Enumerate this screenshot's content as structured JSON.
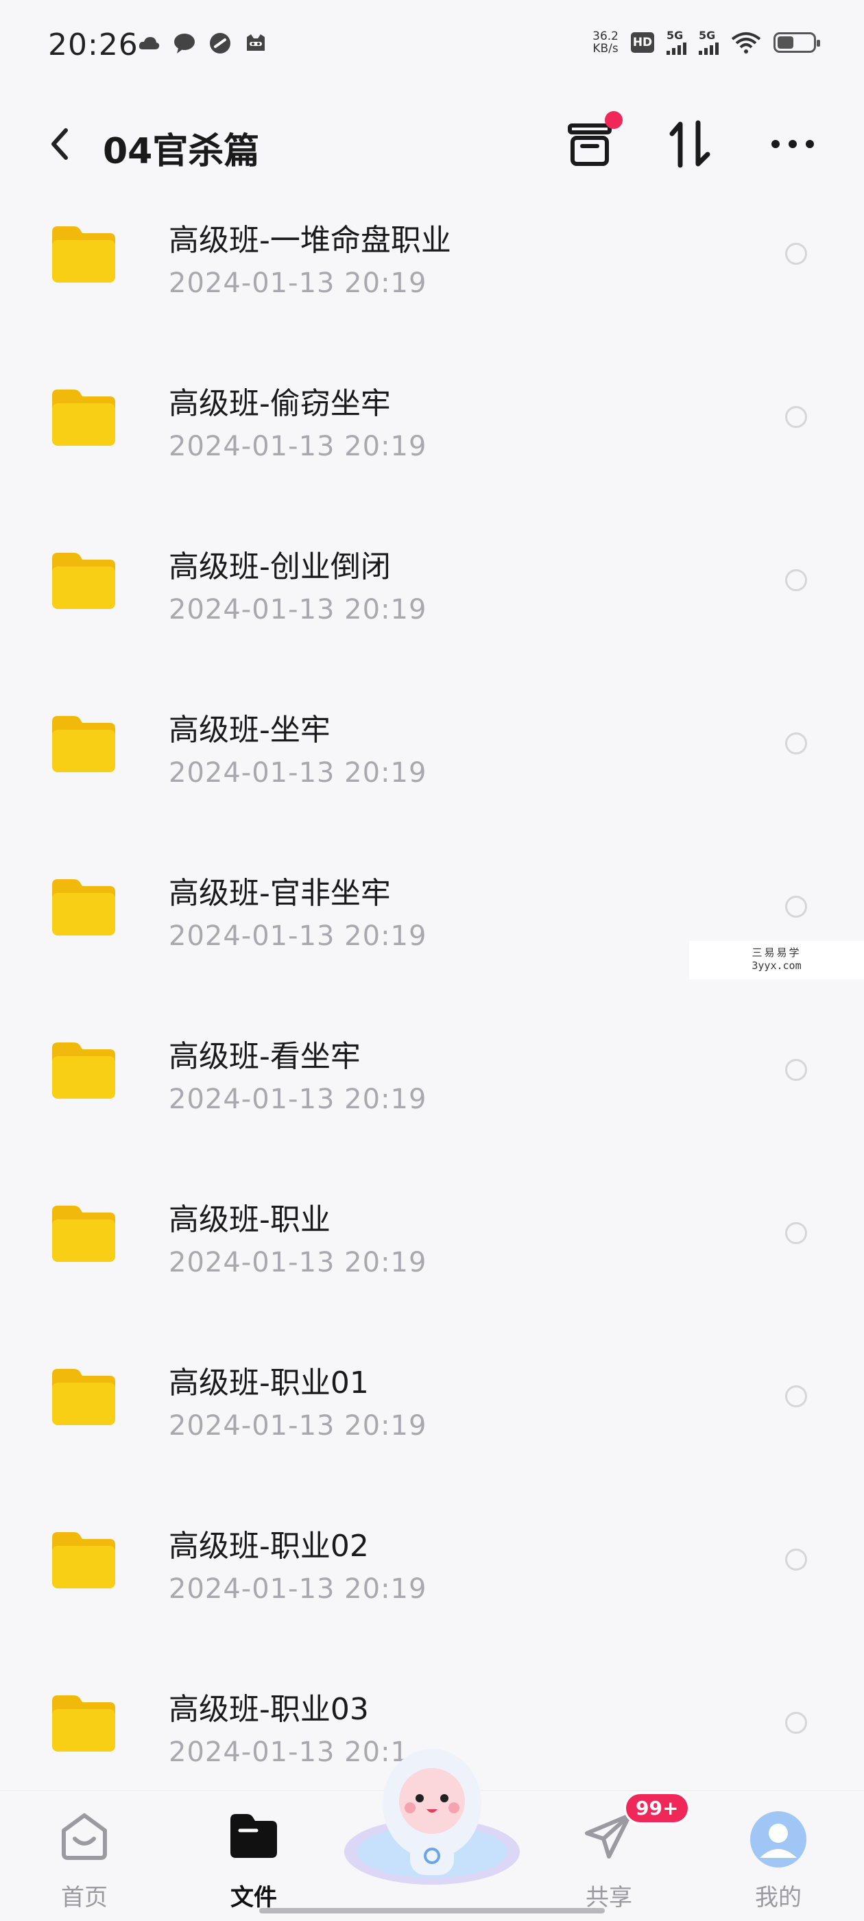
{
  "status_bar": {
    "time": "20:26",
    "net_speed_value": "36.2",
    "net_speed_unit": "KB/s",
    "hd_label": "HD",
    "sim1_label": "5G",
    "sim2_label": "5G",
    "battery_level": 0.45,
    "left_icons": [
      "cloud-icon",
      "chat-bubble-icon",
      "link-icon",
      "cat-face-icon"
    ]
  },
  "header": {
    "title": "04官杀篇",
    "icons": [
      "back-chevron-icon",
      "archive-box-icon",
      "sort-arrows-icon",
      "more-dots-icon"
    ]
  },
  "files": [
    {
      "name": "高级班-一堆命盘职业",
      "date": "2024-01-13  20:19"
    },
    {
      "name": "高级班-偷窃坐牢",
      "date": "2024-01-13  20:19"
    },
    {
      "name": "高级班-创业倒闭",
      "date": "2024-01-13  20:19"
    },
    {
      "name": "高级班-坐牢",
      "date": "2024-01-13  20:19"
    },
    {
      "name": "高级班-官非坐牢",
      "date": "2024-01-13  20:19"
    },
    {
      "name": "高级班-看坐牢",
      "date": "2024-01-13  20:19"
    },
    {
      "name": "高级班-职业",
      "date": "2024-01-13  20:19"
    },
    {
      "name": "高级班-职业01",
      "date": "2024-01-13  20:19"
    },
    {
      "name": "高级班-职业02",
      "date": "2024-01-13  20:19"
    },
    {
      "name": "高级班-职业03",
      "date": "2024-01-13  20:1"
    }
  ],
  "watermark": {
    "line1": "三易易学",
    "line2": "3yyx.com"
  },
  "bottom_nav": {
    "home": "首页",
    "files": "文件",
    "share": "共享",
    "mine": "我的",
    "share_badge": "99+"
  },
  "colors": {
    "background": "#f7f7f9",
    "folder": "#f9cf16",
    "accent_red": "#f0285a",
    "date_gray": "#a8a8ae"
  }
}
